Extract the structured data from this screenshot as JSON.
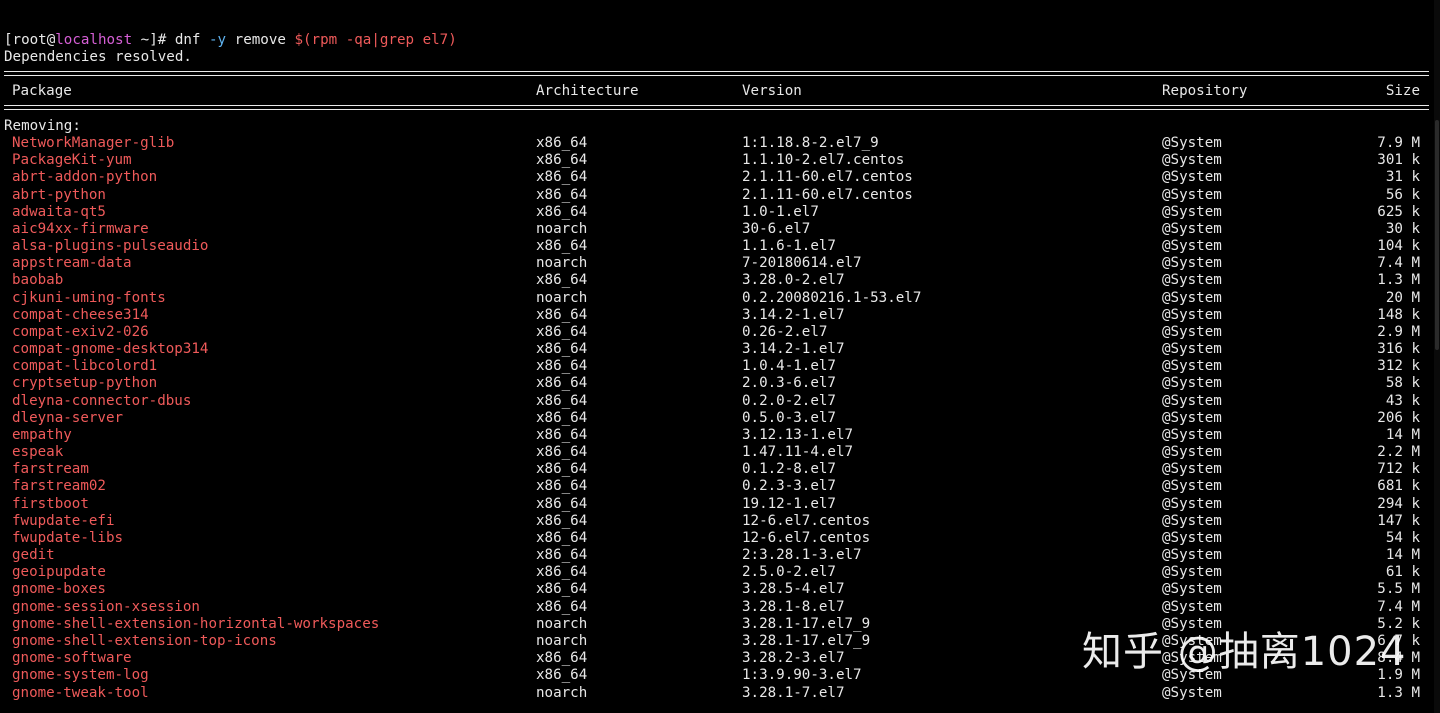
{
  "prompt": {
    "user_open": "[root@",
    "host": "localhost",
    "path": " ~]# ",
    "cmd": "dnf ",
    "flag": "-y",
    "cmd_rest": " remove ",
    "subst": "$(rpm -qa|grep el7)"
  },
  "resolved": "Dependencies resolved.",
  "headers": {
    "package": "Package",
    "architecture": "Architecture",
    "version": "Version",
    "repository": "Repository",
    "size": "Size"
  },
  "removing_label": "Removing:",
  "packages": [
    {
      "name": "NetworkManager-glib",
      "arch": "x86_64",
      "version": "1:1.18.8-2.el7_9",
      "repo": "@System",
      "size": "7.9 M"
    },
    {
      "name": "PackageKit-yum",
      "arch": "x86_64",
      "version": "1.1.10-2.el7.centos",
      "repo": "@System",
      "size": "301 k"
    },
    {
      "name": "abrt-addon-python",
      "arch": "x86_64",
      "version": "2.1.11-60.el7.centos",
      "repo": "@System",
      "size": "31 k"
    },
    {
      "name": "abrt-python",
      "arch": "x86_64",
      "version": "2.1.11-60.el7.centos",
      "repo": "@System",
      "size": "56 k"
    },
    {
      "name": "adwaita-qt5",
      "arch": "x86_64",
      "version": "1.0-1.el7",
      "repo": "@System",
      "size": "625 k"
    },
    {
      "name": "aic94xx-firmware",
      "arch": "noarch",
      "version": "30-6.el7",
      "repo": "@System",
      "size": "30 k"
    },
    {
      "name": "alsa-plugins-pulseaudio",
      "arch": "x86_64",
      "version": "1.1.6-1.el7",
      "repo": "@System",
      "size": "104 k"
    },
    {
      "name": "appstream-data",
      "arch": "noarch",
      "version": "7-20180614.el7",
      "repo": "@System",
      "size": "7.4 M"
    },
    {
      "name": "baobab",
      "arch": "x86_64",
      "version": "3.28.0-2.el7",
      "repo": "@System",
      "size": "1.3 M"
    },
    {
      "name": "cjkuni-uming-fonts",
      "arch": "noarch",
      "version": "0.2.20080216.1-53.el7",
      "repo": "@System",
      "size": "20 M"
    },
    {
      "name": "compat-cheese314",
      "arch": "x86_64",
      "version": "3.14.2-1.el7",
      "repo": "@System",
      "size": "148 k"
    },
    {
      "name": "compat-exiv2-026",
      "arch": "x86_64",
      "version": "0.26-2.el7",
      "repo": "@System",
      "size": "2.9 M"
    },
    {
      "name": "compat-gnome-desktop314",
      "arch": "x86_64",
      "version": "3.14.2-1.el7",
      "repo": "@System",
      "size": "316 k"
    },
    {
      "name": "compat-libcolord1",
      "arch": "x86_64",
      "version": "1.0.4-1.el7",
      "repo": "@System",
      "size": "312 k"
    },
    {
      "name": "cryptsetup-python",
      "arch": "x86_64",
      "version": "2.0.3-6.el7",
      "repo": "@System",
      "size": "58 k"
    },
    {
      "name": "dleyna-connector-dbus",
      "arch": "x86_64",
      "version": "0.2.0-2.el7",
      "repo": "@System",
      "size": "43 k"
    },
    {
      "name": "dleyna-server",
      "arch": "x86_64",
      "version": "0.5.0-3.el7",
      "repo": "@System",
      "size": "206 k"
    },
    {
      "name": "empathy",
      "arch": "x86_64",
      "version": "3.12.13-1.el7",
      "repo": "@System",
      "size": "14 M"
    },
    {
      "name": "espeak",
      "arch": "x86_64",
      "version": "1.47.11-4.el7",
      "repo": "@System",
      "size": "2.2 M"
    },
    {
      "name": "farstream",
      "arch": "x86_64",
      "version": "0.1.2-8.el7",
      "repo": "@System",
      "size": "712 k"
    },
    {
      "name": "farstream02",
      "arch": "x86_64",
      "version": "0.2.3-3.el7",
      "repo": "@System",
      "size": "681 k"
    },
    {
      "name": "firstboot",
      "arch": "x86_64",
      "version": "19.12-1.el7",
      "repo": "@System",
      "size": "294 k"
    },
    {
      "name": "fwupdate-efi",
      "arch": "x86_64",
      "version": "12-6.el7.centos",
      "repo": "@System",
      "size": "147 k"
    },
    {
      "name": "fwupdate-libs",
      "arch": "x86_64",
      "version": "12-6.el7.centos",
      "repo": "@System",
      "size": "54 k"
    },
    {
      "name": "gedit",
      "arch": "x86_64",
      "version": "2:3.28.1-3.el7",
      "repo": "@System",
      "size": "14 M"
    },
    {
      "name": "geoipupdate",
      "arch": "x86_64",
      "version": "2.5.0-2.el7",
      "repo": "@System",
      "size": "61 k"
    },
    {
      "name": "gnome-boxes",
      "arch": "x86_64",
      "version": "3.28.5-4.el7",
      "repo": "@System",
      "size": "5.5 M"
    },
    {
      "name": "gnome-session-xsession",
      "arch": "x86_64",
      "version": "3.28.1-8.el7",
      "repo": "@System",
      "size": "7.4 M"
    },
    {
      "name": "gnome-shell-extension-horizontal-workspaces",
      "arch": "noarch",
      "version": "3.28.1-17.el7_9",
      "repo": "@System",
      "size": "5.2 k"
    },
    {
      "name": "gnome-shell-extension-top-icons",
      "arch": "noarch",
      "version": "3.28.1-17.el7_9",
      "repo": "@System",
      "size": "6.7 k"
    },
    {
      "name": "gnome-software",
      "arch": "x86_64",
      "version": "3.28.2-3.el7",
      "repo": "@System",
      "size": "8.4 M"
    },
    {
      "name": "gnome-system-log",
      "arch": "x86_64",
      "version": "1:3.9.90-3.el7",
      "repo": "@System",
      "size": "1.9 M"
    },
    {
      "name": "gnome-tweak-tool",
      "arch": "noarch",
      "version": "3.28.1-7.el7",
      "repo": "@System",
      "size": "1.3 M"
    }
  ],
  "watermark": "知乎 @抽离1024",
  "colors": {
    "background": "#000000",
    "text": "#e8e8e8",
    "package_name": "#ef5a5a",
    "hostname": "#d65fd6",
    "flag": "#5fb3f0"
  }
}
